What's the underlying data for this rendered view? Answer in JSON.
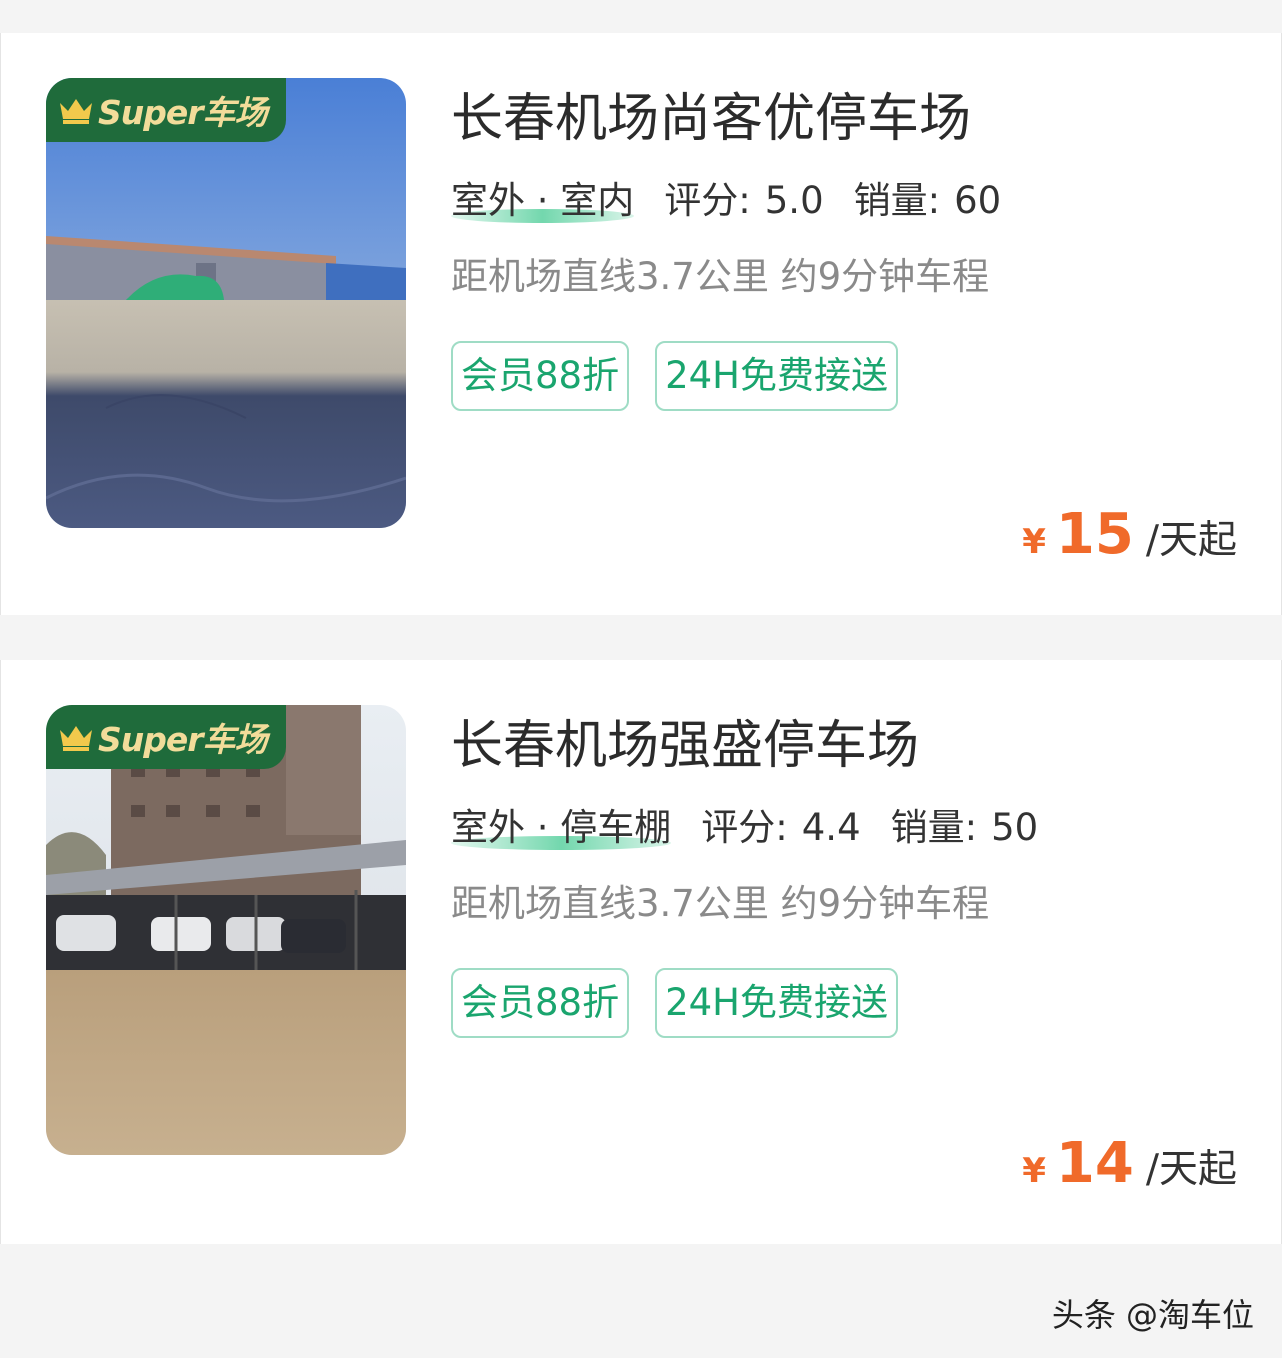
{
  "listings": [
    {
      "badge": "Super车场",
      "name": "长春机场尚客优停车场",
      "type": "室外 · 室内",
      "rating_label": "评分:",
      "rating": "5.0",
      "sales_label": "销量:",
      "sales": "60",
      "distance": "距机场直线3.7公里 约9分钟车程",
      "tags": [
        "会员88折",
        "24H免费接送"
      ],
      "price_symbol": "¥",
      "price": "15",
      "price_unit": "/天起"
    },
    {
      "badge": "Super车场",
      "name": "长春机场强盛停车场",
      "type": "室外 · 停车棚",
      "rating_label": "评分:",
      "rating": "4.4",
      "sales_label": "销量:",
      "sales": "50",
      "distance": "距机场直线3.7公里 约9分钟车程",
      "tags": [
        "会员88折",
        "24H免费接送"
      ],
      "price_symbol": "¥",
      "price": "14",
      "price_unit": "/天起"
    }
  ],
  "watermark": "头条 @淘车位",
  "colors": {
    "accent": "#f06a2a",
    "tag_green": "#1aa56e",
    "badge_green": "#1f6b3b",
    "badge_gold": "#f2dc9a"
  },
  "icons": {
    "badge_icon": "crown-icon"
  }
}
